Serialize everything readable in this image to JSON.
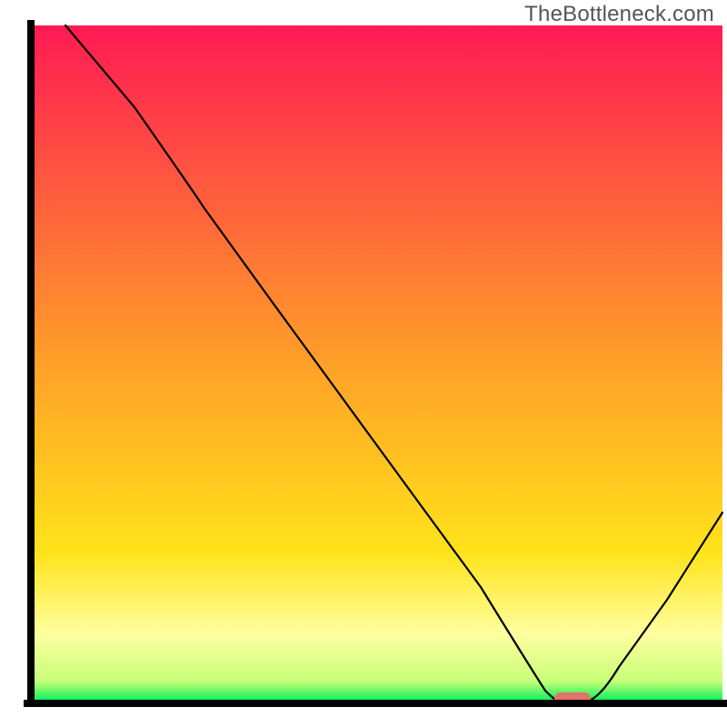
{
  "watermark": "TheBottleneck.com",
  "colors": {
    "top_red": "#ff1a53",
    "mid_orange": "#ffa028",
    "mid_yellow": "#ffe31a",
    "pale_yellow": "#ffff9f",
    "bright_green": "#00f05a",
    "axis_black": "#000000",
    "marker_red": "#e2746b",
    "background": "#ffffff"
  },
  "chart_data": {
    "type": "line",
    "title": "",
    "xlabel": "",
    "ylabel": "",
    "xlim": [
      0,
      100
    ],
    "ylim": [
      0,
      100
    ],
    "series": [
      {
        "name": "curve",
        "x": [
          5,
          15,
          25,
          35,
          45,
          55,
          65,
          72,
          76.5,
          80,
          85,
          92,
          100
        ],
        "y": [
          100,
          88,
          74,
          59,
          45,
          31,
          17,
          5,
          0,
          0,
          5,
          15,
          28
        ]
      }
    ],
    "marker": {
      "x": 78,
      "y": 0,
      "shape": "pill",
      "color": "#e2746b"
    },
    "gradient_stops_vertical": [
      {
        "pos": 0.0,
        "color": "#ff1a53"
      },
      {
        "pos": 0.5,
        "color": "#ffa028"
      },
      {
        "pos": 0.78,
        "color": "#ffe31a"
      },
      {
        "pos": 0.9,
        "color": "#ffff9f"
      },
      {
        "pos": 0.97,
        "color": "#c8ff78"
      },
      {
        "pos": 1.0,
        "color": "#00f05a"
      }
    ],
    "notes": "No numeric axis labels are visible in the image; values above are relative 0–100 readings of curve position within the plot area."
  }
}
